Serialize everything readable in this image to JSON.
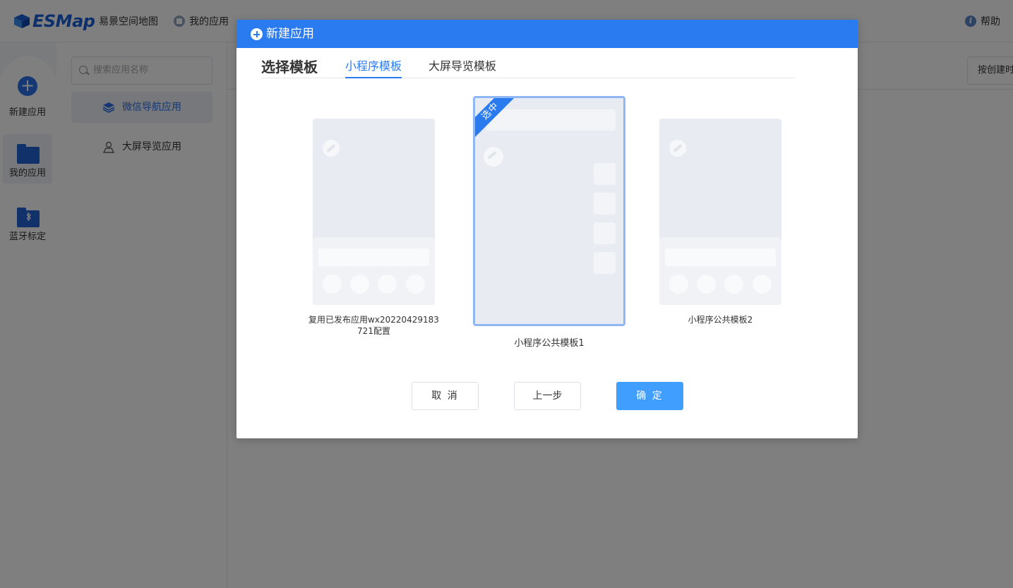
{
  "topbar": {
    "logo_text": "ESMap",
    "brand_name": "易景空间地图",
    "my_apps_label": "我的应用",
    "help_label": "帮助"
  },
  "leftrail": {
    "items": [
      {
        "label": "新建应用",
        "icon": "plus-circle-icon"
      },
      {
        "label": "我的应用",
        "icon": "folder-icon"
      },
      {
        "label": "蓝牙标定",
        "icon": "bluetooth-folder-icon"
      }
    ]
  },
  "subsidebar": {
    "search_placeholder": "搜索应用名称",
    "items": [
      {
        "label": "微信导航应用",
        "icon": "layers-icon"
      },
      {
        "label": "大屏导览应用",
        "icon": "map-pin-user-icon"
      }
    ]
  },
  "main": {
    "sort_button_label": "按创建时"
  },
  "modal": {
    "title": "新建应用",
    "section_title": "选择模板",
    "tabs": [
      {
        "label": "小程序模板"
      },
      {
        "label": "大屏导览模板"
      }
    ],
    "templates": [
      {
        "caption_line1": "复用已发布应用wx20220429183",
        "caption_line2": "721配置"
      },
      {
        "caption": "小程序公共模板1",
        "ribbon": "选中"
      },
      {
        "caption": "小程序公共模板2"
      }
    ],
    "buttons": {
      "cancel": "取 消",
      "prev": "上一步",
      "confirm": "确 定"
    }
  },
  "colors": {
    "primary": "#2a7af0",
    "confirm_button": "#409eff",
    "selected_border": "#8fb7f6"
  }
}
